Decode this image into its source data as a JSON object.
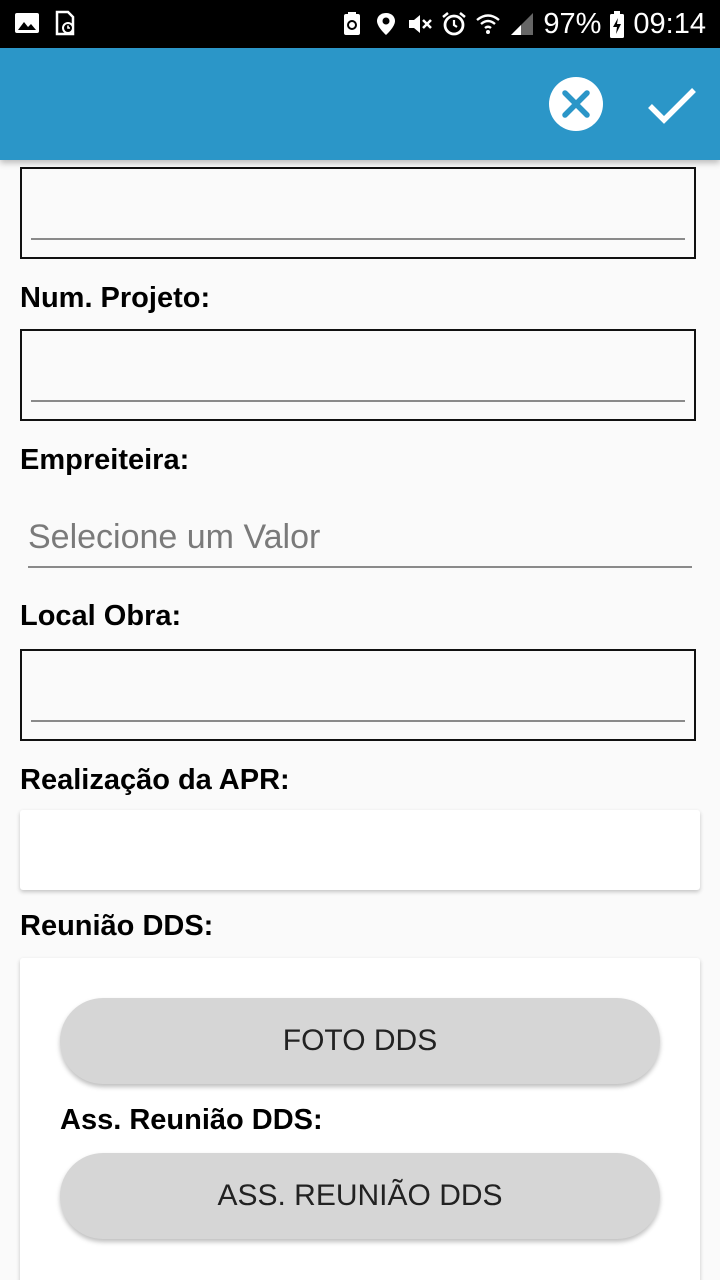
{
  "status_bar": {
    "battery": "97%",
    "time": "09:14",
    "icons": [
      "image-icon",
      "sim-icon",
      "recycle-icon",
      "location-icon",
      "mute-icon",
      "alarm-icon",
      "wifi-icon",
      "signal-icon",
      "battery-charging-icon"
    ]
  },
  "app_bar": {
    "color": "#2b96c8",
    "actions": [
      "close-icon",
      "check-icon"
    ]
  },
  "form": {
    "num_projeto_label": "Num. Projeto:",
    "empreiteira_label": "Empreiteira:",
    "empreiteira_placeholder": "Selecione um Valor",
    "local_obra_label": "Local Obra:",
    "realizacao_apr_label": "Realização da APR:",
    "reuniao_dds_label": "Reunião DDS:",
    "foto_dds_button": "FOTO DDS",
    "ass_reuniao_label": "Ass. Reunião DDS:",
    "ass_reuniao_button": "ASS. REUNIÃO DDS"
  }
}
